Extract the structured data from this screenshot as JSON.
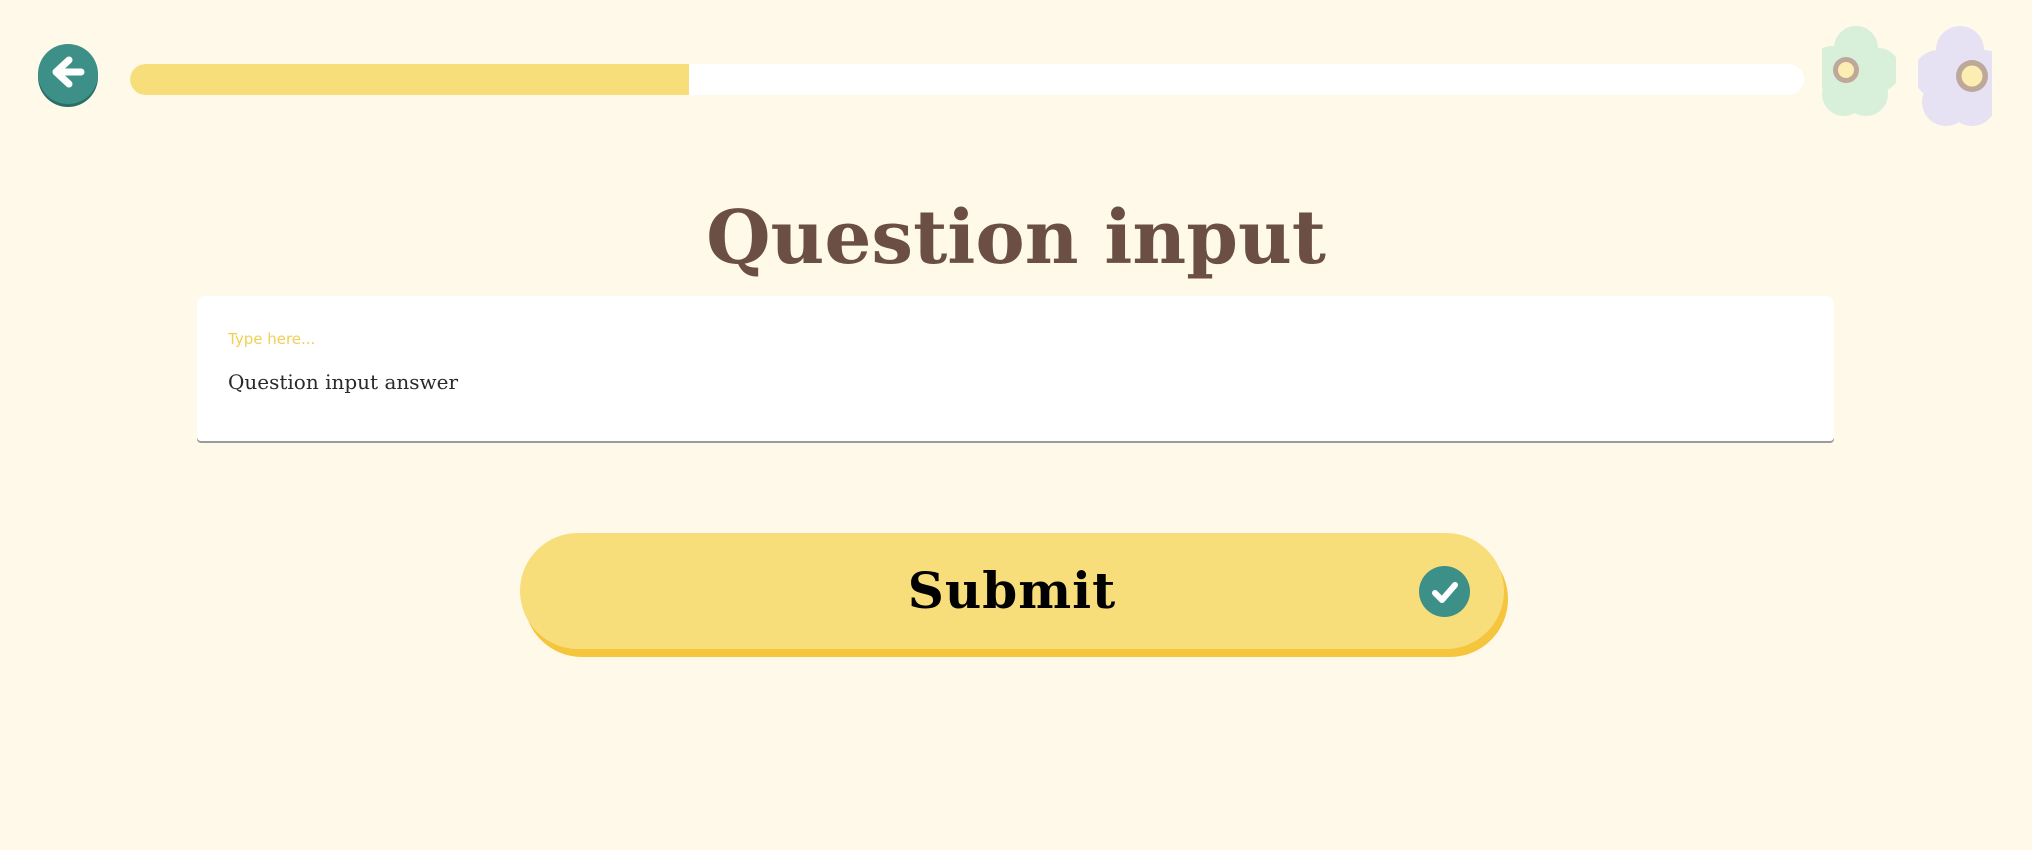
{
  "header": {
    "back_button_icon": "arrow-left-icon",
    "progress": 0.334,
    "progress_color": "#f8de7a",
    "decorations": [
      "green-flower-icon",
      "lavender-flower-icon"
    ]
  },
  "main": {
    "title": "Question input",
    "input": {
      "placeholder_label": "Type here...",
      "value": "Question input answer"
    },
    "submit": {
      "label": "Submit",
      "icon": "check-icon"
    }
  },
  "colors": {
    "background": "#fef9e8",
    "accent_yellow": "#f8de7a",
    "accent_teal": "#3d9088",
    "title_brown": "#6b4f45"
  }
}
